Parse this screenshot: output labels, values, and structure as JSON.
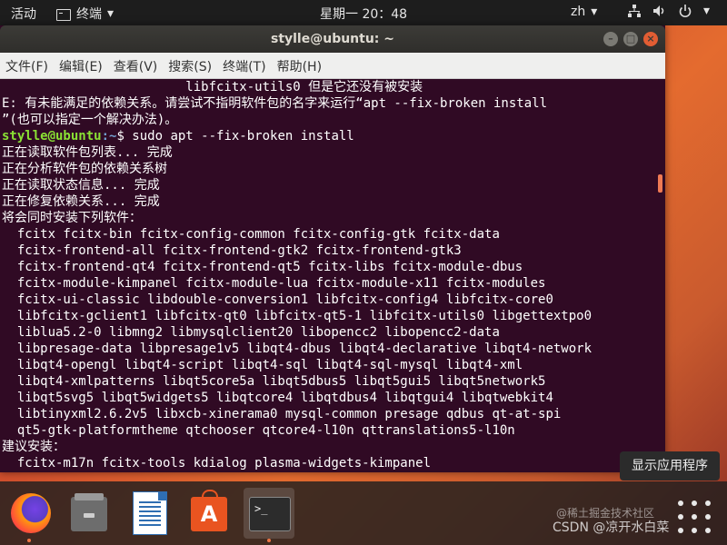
{
  "topbar": {
    "activities": "活动",
    "app_name": "终端",
    "clock": "星期一 20：48",
    "language": "zh"
  },
  "window": {
    "title": "stylle@ubuntu: ~",
    "menu": [
      "文件(F)",
      "编辑(E)",
      "查看(V)",
      "搜索(S)",
      "终端(T)",
      "帮助(H)"
    ]
  },
  "terminal": {
    "lines": [
      "                        libfcitx-utils0 但是它还没有被安装",
      "E: 有未能满足的依赖关系。请尝试不指明软件包的名字来运行“apt --fix-broken install",
      "”(也可以指定一个解决办法)。",
      "__PROMPT__",
      "正在读取软件包列表... 完成",
      "正在分析软件包的依赖关系树",
      "正在读取状态信息... 完成",
      "正在修复依赖关系... 完成",
      "将会同时安装下列软件：",
      "  fcitx fcitx-bin fcitx-config-common fcitx-config-gtk fcitx-data",
      "  fcitx-frontend-all fcitx-frontend-gtk2 fcitx-frontend-gtk3",
      "  fcitx-frontend-qt4 fcitx-frontend-qt5 fcitx-libs fcitx-module-dbus",
      "  fcitx-module-kimpanel fcitx-module-lua fcitx-module-x11 fcitx-modules",
      "  fcitx-ui-classic libdouble-conversion1 libfcitx-config4 libfcitx-core0",
      "  libfcitx-gclient1 libfcitx-qt0 libfcitx-qt5-1 libfcitx-utils0 libgettextpo0",
      "  liblua5.2-0 libmng2 libmysqlclient20 libopencc2 libopencc2-data",
      "  libpresage-data libpresage1v5 libqt4-dbus libqt4-declarative libqt4-network",
      "  libqt4-opengl libqt4-script libqt4-sql libqt4-sql-mysql libqt4-xml",
      "  libqt4-xmlpatterns libqt5core5a libqt5dbus5 libqt5gui5 libqt5network5",
      "  libqt5svg5 libqt5widgets5 libqtcore4 libqtdbus4 libqtgui4 libqtwebkit4",
      "  libtinyxml2.6.2v5 libxcb-xinerama0 mysql-common presage qdbus qt-at-spi",
      "  qt5-gtk-platformtheme qtchooser qtcore4-l10n qttranslations5-l10n",
      "建议安装：",
      "  fcitx-m17n fcitx-tools kdialog plasma-widgets-kimpanel"
    ],
    "prompt": {
      "user_host": "stylle@ubuntu",
      "path": ":~",
      "command": "$ sudo apt --fix-broken install"
    }
  },
  "tooltip": "显示应用程序",
  "dock": {
    "apps": [
      "firefox",
      "files",
      "libreoffice-writer",
      "ubuntu-software",
      "terminal"
    ]
  },
  "watermark": {
    "top": "@稀土掘金技术社区",
    "bottom": "CSDN @凉开水白菜"
  }
}
